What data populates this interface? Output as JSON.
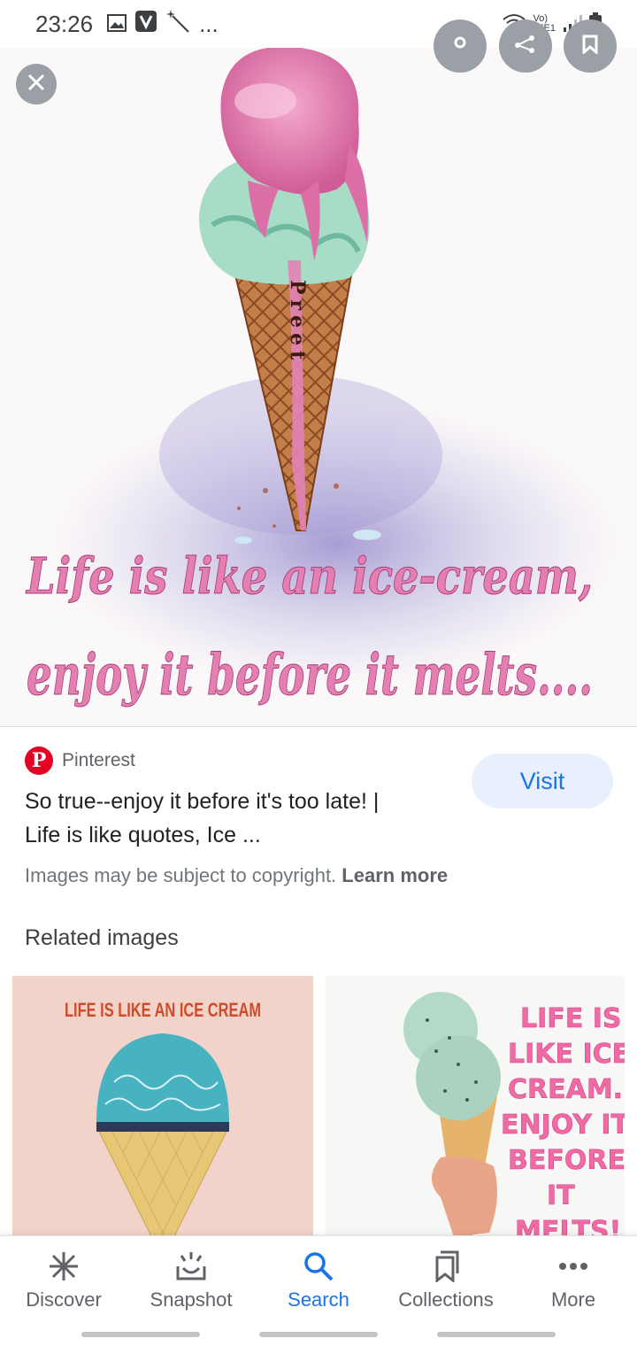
{
  "status_bar": {
    "time": "23:26",
    "overflow": "...",
    "network_label": "LTE1",
    "volte_label": "Vo)",
    "icons": [
      "gallery-icon",
      "v-app-icon",
      "magic-wand-icon",
      "wifi-icon",
      "signal-icon",
      "battery-icon"
    ]
  },
  "hero": {
    "caption_line1": "Life is like an ice-cream,",
    "caption_line2": "enjoy it before it melts....",
    "cone_text": "Preet"
  },
  "result": {
    "source_name": "Pinterest",
    "title_line1": "So true--enjoy it before it's too late! |",
    "title_line2": "Life is like quotes, Ice ...",
    "visit_label": "Visit",
    "copyright_text": "Images may be subject to copyright.",
    "learn_more": "Learn more"
  },
  "related": {
    "heading": "Related images",
    "items": [
      {
        "caption": "LIFE IS LIKE AN ICE CREAM"
      },
      {
        "lines": [
          "LIFE IS",
          "LIKE ICE",
          "CREAM.",
          "ENJOY IT",
          "BEFORE",
          "IT",
          "MELTS!"
        ]
      }
    ]
  },
  "nav": {
    "items": [
      {
        "label": "Discover",
        "icon": "asterisk-icon"
      },
      {
        "label": "Snapshot",
        "icon": "snapshot-icon"
      },
      {
        "label": "Search",
        "icon": "search-icon"
      },
      {
        "label": "Collections",
        "icon": "collections-icon"
      },
      {
        "label": "More",
        "icon": "more-dots-icon"
      }
    ],
    "active": "Search"
  },
  "colors": {
    "accent": "#1a73e8",
    "pinterest": "#e60023",
    "caption_pink": "#e37fb1"
  }
}
